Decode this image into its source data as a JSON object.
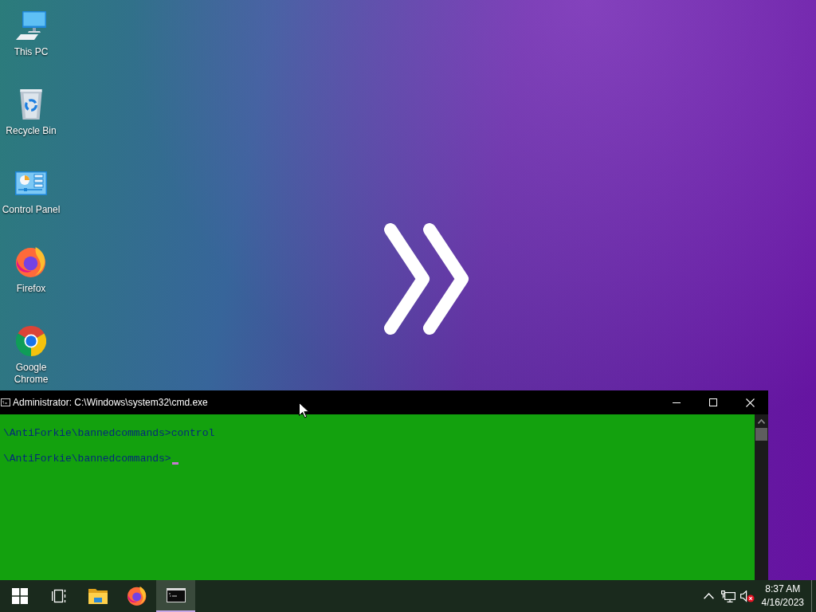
{
  "desktop": {
    "shortcuts": [
      {
        "kind": "computer",
        "label": "This PC"
      },
      {
        "kind": "recycle-bin",
        "label": "Recycle Bin"
      },
      {
        "kind": "control-panel",
        "label": "Control Panel"
      },
      {
        "kind": "firefox",
        "label": "Firefox"
      },
      {
        "kind": "chrome",
        "label": "Google Chrome"
      }
    ]
  },
  "console_window": {
    "title": "Administrator: C:\\Windows\\system32\\cmd.exe",
    "lines": [
      {
        "text": "\\AntiForkie\\bannedcommands>control",
        "cursor": false
      },
      {
        "text": "\\AntiForkie\\bannedcommands>",
        "cursor": true
      }
    ]
  },
  "taskbar": {
    "buttons": [
      {
        "kind": "start",
        "selected": false
      },
      {
        "kind": "task-view",
        "selected": false
      },
      {
        "kind": "file-explorer",
        "selected": false
      },
      {
        "kind": "firefox",
        "selected": false
      },
      {
        "kind": "command-prompt",
        "selected": true
      }
    ],
    "tray": {
      "volume": {
        "muted": true
      },
      "clock": {
        "time": "8:37 AM",
        "date": "4/16/2023"
      }
    }
  }
}
